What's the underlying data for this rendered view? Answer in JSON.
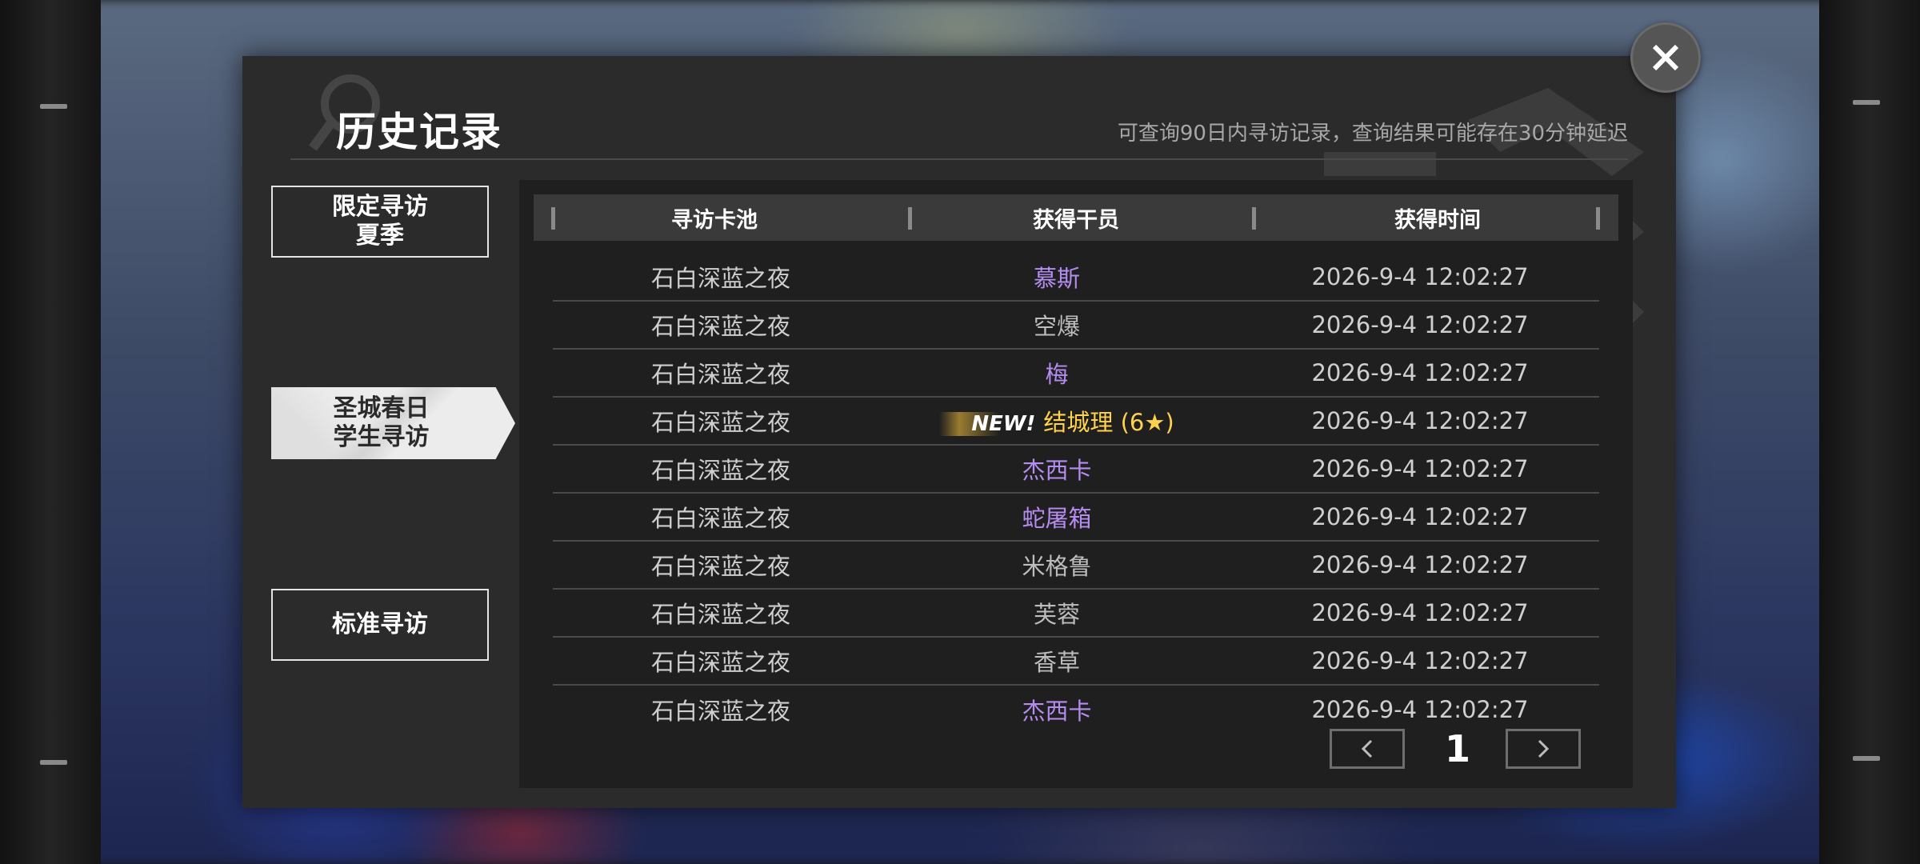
{
  "header": {
    "title": "历史记录",
    "subtitle": "可查询90日内寻访记录，查询结果可能存在30分钟延迟"
  },
  "tabs": [
    {
      "label": "限定寻访\n夏季",
      "active": false
    },
    {
      "label": "圣城春日\n学生寻访",
      "active": true
    },
    {
      "label": "标准寻访",
      "active": false
    }
  ],
  "table": {
    "columns": [
      "寻访卡池",
      "获得干员",
      "获得时间"
    ],
    "rows": [
      {
        "pool": "石白深蓝之夜",
        "operator": "慕斯",
        "time": "2026-9-4 12:02:27",
        "rarity": "purple"
      },
      {
        "pool": "石白深蓝之夜",
        "operator": "空爆",
        "time": "2026-9-4 12:02:27",
        "rarity": "gray"
      },
      {
        "pool": "石白深蓝之夜",
        "operator": "梅",
        "time": "2026-9-4 12:02:27",
        "rarity": "purple"
      },
      {
        "pool": "石白深蓝之夜",
        "operator": "结城理 (6★)",
        "time": "2026-9-4 12:02:27",
        "rarity": "gold",
        "badge": "NEW!"
      },
      {
        "pool": "石白深蓝之夜",
        "operator": "杰西卡",
        "time": "2026-9-4 12:02:27",
        "rarity": "purple"
      },
      {
        "pool": "石白深蓝之夜",
        "operator": "蛇屠箱",
        "time": "2026-9-4 12:02:27",
        "rarity": "purple"
      },
      {
        "pool": "石白深蓝之夜",
        "operator": "米格鲁",
        "time": "2026-9-4 12:02:27",
        "rarity": "gray"
      },
      {
        "pool": "石白深蓝之夜",
        "operator": "芙蓉",
        "time": "2026-9-4 12:02:27",
        "rarity": "gray"
      },
      {
        "pool": "石白深蓝之夜",
        "operator": "香草",
        "time": "2026-9-4 12:02:27",
        "rarity": "gray"
      },
      {
        "pool": "石白深蓝之夜",
        "operator": "杰西卡",
        "time": "2026-9-4 12:02:27",
        "rarity": "purple"
      }
    ]
  },
  "pager": {
    "page": "1",
    "prev_icon": "chevron-left-icon",
    "next_icon": "chevron-right-icon"
  },
  "close_icon": "close-icon",
  "colors": {
    "purple": "#b58cf0",
    "gold": "#ffd24d",
    "gray": "#bdbdbd",
    "panel": "#2b2b2b"
  }
}
